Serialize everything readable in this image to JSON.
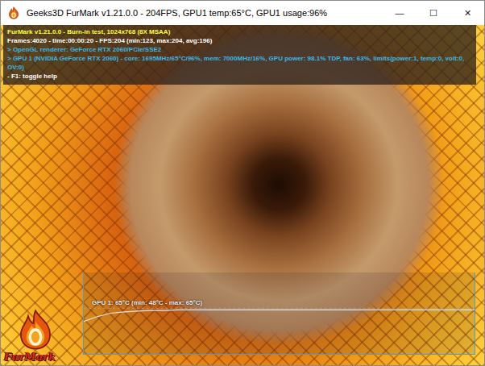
{
  "window": {
    "title": "Geeks3D FurMark v1.21.0.0 - 204FPS, GPU1 temp:65°C, GPU1 usage:96%",
    "controls": [
      "—",
      "☐",
      "✕"
    ]
  },
  "info": [
    {
      "text": "FurMark v1.21.0.0 - Burn-in test, 1024x768 (8X MSAA)",
      "color": "#ffff40"
    },
    {
      "text": "Frames:4020 - time:00:00:20 - FPS:204 (min:123, max:204, avg:196)",
      "color": "#ffffff"
    },
    {
      "text": "> OpenGL renderer: GeForce RTX 2060/PCIe/SSE2",
      "color": "#39b8ea"
    },
    {
      "text": "> GPU 1 (NVIDIA GeForce RTX 2060) - core: 1695MHz/65°C/96%, mem: 7000MHz/16%, GPU power: 98.1% TDP, fan: 63%, limits(power:1, temp:0, volt:0, OV:0)",
      "color": "#39b8ea"
    },
    {
      "text": "- F1: toggle help",
      "color": "#ffffff"
    }
  ],
  "graph": {
    "label": "GPU 1: 65°C (min: 48°C - max: 65°C)",
    "series": [
      {
        "name": "GPU 1",
        "values": [
          48,
          55,
          60,
          62,
          63,
          64,
          64,
          65,
          65,
          65,
          65,
          65,
          65,
          65,
          65,
          65,
          65,
          65,
          65,
          65,
          65,
          65,
          65,
          65,
          65,
          65,
          65,
          65,
          65,
          65
        ]
      }
    ]
  },
  "logo": {
    "text": "FurMark"
  }
}
